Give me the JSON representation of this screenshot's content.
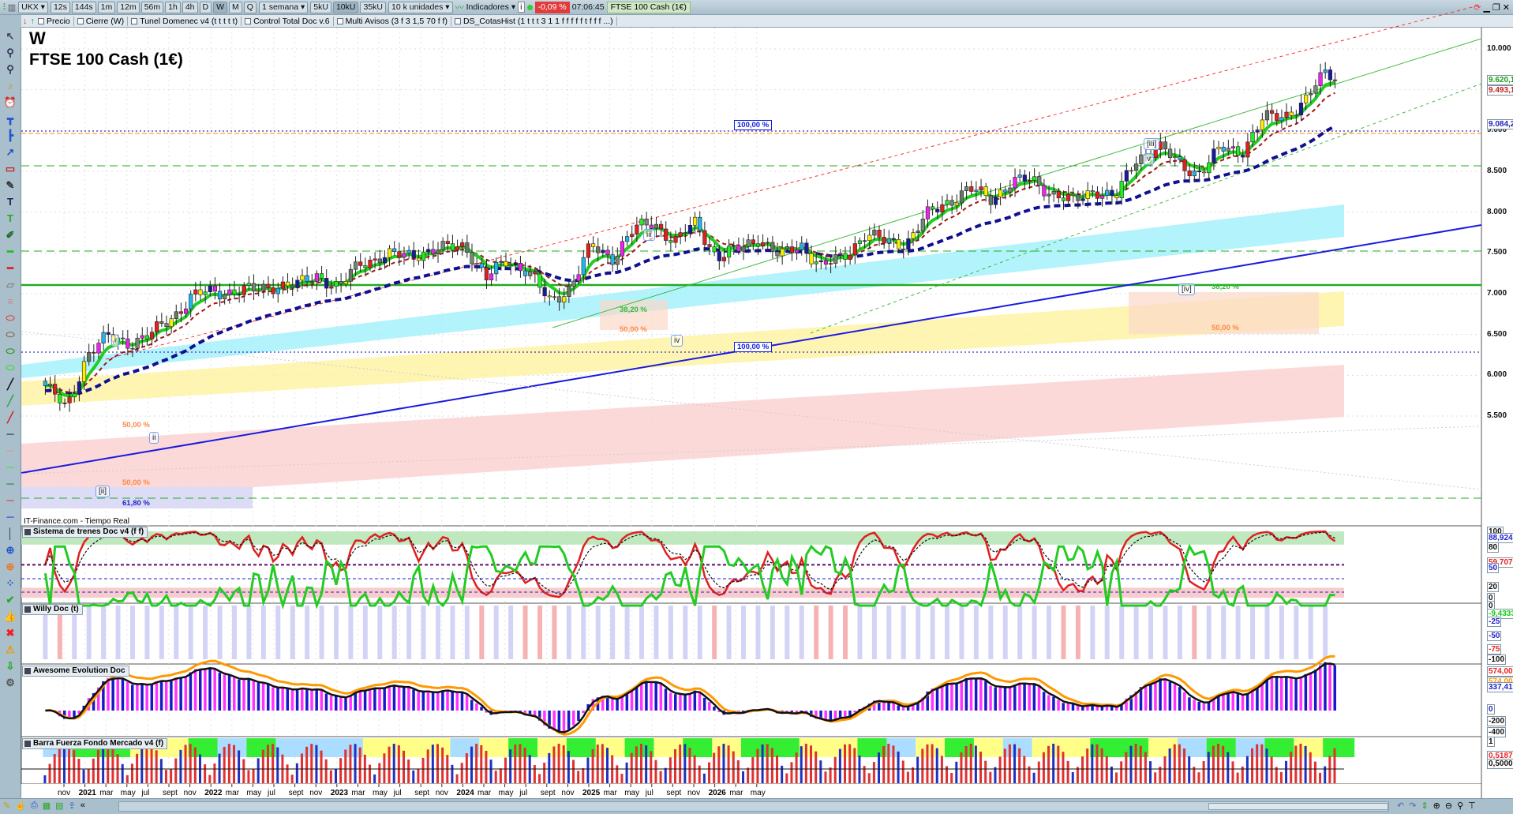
{
  "toolbar": {
    "symbol": "UKX",
    "intervals": [
      "12s",
      "144s",
      "1m",
      "12m",
      "56m",
      "1h",
      "4h",
      "D",
      "W",
      "M",
      "Q"
    ],
    "active_interval": "W",
    "period": "1 semana",
    "units": [
      "5kU",
      "10kU",
      "35kU"
    ],
    "active_unit": "10kU",
    "units_select": "10 k unidades",
    "indicators": "Indicadores",
    "change": "-0,09 %",
    "time": "07:06:45",
    "instrument": "FTSE 100 Cash (1€)"
  },
  "indicators_bar": [
    "Precio",
    "Cierre (W)",
    "Tunel Domenec v4 (t t t t t)",
    "Control Total Doc v.6",
    "Multi Avisos (3 f 3 1,5 70 f f)",
    "DS_CotasHist (1 t t t 3 1 1 f f f f f t f f f ...)"
  ],
  "chart": {
    "timeframe": "W",
    "title": "FTSE 100 Cash (1€)",
    "source": "IT-Finance.com - Tiempo Real",
    "price_ticks": [
      "10.000",
      "9.000",
      "8.500",
      "8.000",
      "7.500",
      "7.000",
      "6.500",
      "6.000",
      "5.500"
    ],
    "price_labels": {
      "green": "9.620,1",
      "red": "9.493,1",
      "blue": "9.084,2"
    },
    "waves": [
      "i",
      "ii",
      "[ii]",
      "iii",
      "iv",
      "[iii]",
      "v",
      "[iv]"
    ],
    "fib": {
      "f382": "38,20 %",
      "f50": "50,00 %",
      "f618": "61,80 %",
      "f100": "100,00 %"
    },
    "colors": {
      "up_ma": "#22cc22",
      "trend": "#1a1ae0",
      "channel": "#ff3030",
      "band_cyan": "#9ff0fb",
      "band_yellow": "#fff3a0",
      "band_pink": "#fbd0d0"
    }
  },
  "chart_data": {
    "type": "candlestick",
    "timeframe": "weekly",
    "first_month": "2020-09",
    "monthly_close": [
      5870,
      5580,
      6270,
      6460,
      6410,
      6480,
      6710,
      6970,
      7020,
      7040,
      7030,
      7120,
      7090,
      7240,
      7060,
      7380,
      7460,
      7460,
      7520,
      7540,
      7610,
      7170,
      7420,
      7280,
      6890,
      7090,
      7570,
      7450,
      7770,
      7880,
      7630,
      7870,
      7450,
      7530,
      7700,
      7440,
      7610,
      7320,
      7450,
      7730,
      7630,
      7630,
      7950,
      8140,
      8280,
      8160,
      8370,
      8380,
      8240,
      8110,
      8290,
      8170,
      8670,
      8810,
      8580,
      8490,
      8770,
      8760,
      9130,
      9190,
      9350,
      9720,
      9620
    ],
    "ylim": [
      5300,
      10250
    ]
  },
  "time_axis": [
    "nov",
    "2021",
    "mar",
    "may",
    "jul",
    "sept",
    "nov",
    "2022",
    "mar",
    "may",
    "jul",
    "sept",
    "nov",
    "2023",
    "mar",
    "may",
    "jul",
    "sept",
    "nov",
    "2024",
    "mar",
    "may",
    "jul",
    "sept",
    "nov",
    "2025",
    "mar",
    "may",
    "jul",
    "sept",
    "nov",
    "2026",
    "mar",
    "may"
  ],
  "panels": [
    {
      "title": "Sistema de trenes Doc v4 (f f)",
      "labels": [
        "100",
        "88,924",
        "80",
        "59,707",
        "50",
        "20",
        "0"
      ]
    },
    {
      "title": "Willy Doc (t)",
      "labels": [
        "0",
        "-9,4333",
        "-25",
        "-50",
        "-75",
        "-100"
      ]
    },
    {
      "title": "Awesome Evolution Doc",
      "labels": [
        "574,00",
        "574,00",
        "337,41",
        "0",
        "-200",
        "-400"
      ]
    },
    {
      "title": "Barra Fuerza Fondo Mercado v4 (f)",
      "labels": [
        "1",
        "0,5187",
        "0,5000"
      ]
    }
  ],
  "side_tools": [
    [
      "cursor-icon",
      "↖",
      "#446"
    ],
    [
      "zoom-icon",
      "⚲",
      "#335"
    ],
    [
      "zoom-region-icon",
      "⚲",
      "#335"
    ],
    [
      "bell-icon",
      "♪",
      "#c90"
    ],
    [
      "alarm-icon",
      "⏰",
      "#c90"
    ],
    [
      "horizontal-line-icon",
      "┳",
      "#25c"
    ],
    [
      "vertical-line-icon",
      "┣",
      "#25c"
    ],
    [
      "arrow-icon",
      "↗",
      "#25c"
    ],
    [
      "rectangle-icon",
      "▭",
      "#c22"
    ],
    [
      "brush-icon",
      "✎",
      "#333"
    ],
    [
      "text-icon",
      "T",
      "#225"
    ],
    [
      "text-green-icon",
      "T",
      "#2a2"
    ],
    [
      "pen-icon",
      "✐",
      "#262"
    ],
    [
      "line-green-icon",
      "━",
      "#2b2"
    ],
    [
      "line-red-icon",
      "━",
      "#d22"
    ],
    [
      "ruler-icon",
      "▱",
      "#888"
    ],
    [
      "fibonacci-icon",
      "≡",
      "#c88"
    ],
    [
      "ellipse-red-icon",
      "⬭",
      "#d44"
    ],
    [
      "ellipse-brown-icon",
      "⬭",
      "#864"
    ],
    [
      "ellipse-green-icon",
      "⬭",
      "#292"
    ],
    [
      "ellipse-lime-icon",
      "⬭",
      "#3d3"
    ],
    [
      "line-black-icon",
      "╱",
      "#111"
    ],
    [
      "line-green2-icon",
      "╱",
      "#3a3"
    ],
    [
      "line-red2-icon",
      "╱",
      "#d22"
    ],
    [
      "hline-black-icon",
      "─",
      "#111"
    ],
    [
      "hline-salmon-icon",
      "─",
      "#e88"
    ],
    [
      "hline-lime-icon",
      "─",
      "#2e2"
    ],
    [
      "hline-dkgreen-icon",
      "─",
      "#171"
    ],
    [
      "hline-red-icon",
      "─",
      "#e22"
    ],
    [
      "hline-blue-icon",
      "─",
      "#22c"
    ],
    [
      "vline-icon",
      "│",
      "#333"
    ],
    [
      "magnet-icon",
      "⊕",
      "#25c"
    ],
    [
      "crosshair-icon",
      "⊕",
      "#e72"
    ],
    [
      "grid-icon",
      "⁘",
      "#25c"
    ],
    [
      "check-icon",
      "✔",
      "#2a2"
    ],
    [
      "thumb-icon",
      "👍",
      "#2a2"
    ],
    [
      "delete-icon",
      "✖",
      "#e22"
    ],
    [
      "warning-icon",
      "⚠",
      "#e90"
    ],
    [
      "save-icon",
      "⇩",
      "#2a2"
    ],
    [
      "settings-icon",
      "⚙",
      "#555"
    ]
  ]
}
